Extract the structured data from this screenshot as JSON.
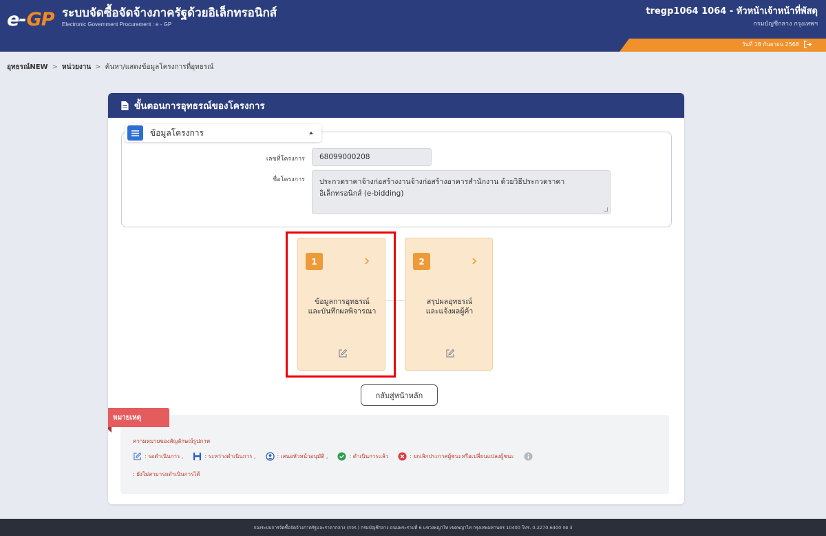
{
  "header": {
    "logo_e": "e-",
    "logo_gp": "GP",
    "title": "ระบบจัดซื้อจัดจ้างภาครัฐด้วยอิเล็กทรอนิกส์",
    "subtitle": "Electronic Government Procurement : e - GP",
    "user_name": "tregp1064 1064 - หัวหน้าเจ้าหน้าที่พัสดุ",
    "user_org": "กรมบัญชีกลาง กรุงเทพฯ",
    "date": "วันที่ 18 กันยายน 2568"
  },
  "breadcrumb": {
    "item1": "อุทธรณ์NEW",
    "item2": "หน่วยงาน",
    "item3": "ค้นหา/แสดงข้อมูลโครงการที่อุทธรณ์",
    "sep": ">"
  },
  "card": {
    "title": "ขั้นตอนการอุทธรณ์ของโครงการ",
    "section_label": "ข้อมูลโครงการ",
    "project_number_label": "เลขที่โครงการ",
    "project_number": "68099000208",
    "project_name_label": "ชื่อโครงการ",
    "project_name": "ประกวดราคาจ้างก่อสร้างงานจ้างก่อสร้างอาคารสำนักงาน ด้วยวิธีประกวดราคาอิเล็กทรอนิกส์ (e-bidding)"
  },
  "steps": [
    {
      "number": "1",
      "line1": "ข้อมูลการอุทธรณ์",
      "line2": "และบันทึกผลพิจารณา"
    },
    {
      "number": "2",
      "line1": "สรุปผลอุทธรณ์",
      "line2": "และแจ้งผลผู้ค้า"
    }
  ],
  "back_button": "กลับสู่หน้าหลัก",
  "note": {
    "ribbon": "หมายเหตุ",
    "heading": "ความหมายของสัญลักษณ์รูปภาพ",
    "items": [
      {
        "icon": "edit-icon",
        "text": ": รอดำเนินการ ,"
      },
      {
        "icon": "save-icon",
        "text": ": ระหว่างดำเนินการ ,"
      },
      {
        "icon": "user-icon",
        "text": ": เสนอหัวหน้าอนุมัติ ,"
      },
      {
        "icon": "check-circle-icon",
        "text": ": ดำเนินการแล้ว"
      },
      {
        "icon": "cancel-circle-icon",
        "text": ": ยกเลิกประกาศผู้ชนะหรือเปลี่ยนแปลงผู้ชนะ"
      },
      {
        "icon": "info-circle-icon",
        "text": ""
      }
    ],
    "last_line": ": ยังไม่สามารถดำเนินการได้"
  },
  "footer": "กองระบบการจัดซื้อจัดจ้างภาครัฐและราคากลาง (กจร.) กรมบัญชีกลาง ถนนพระรามที่ 6 แขวงพญาไท เขตพญาไท กรุงเทพมหานคร 10400 โทร. 0-2270-6400 กด 3",
  "colors": {
    "navy": "#2b3d7c",
    "orange": "#f0912b",
    "step_bg": "#fbe7cc",
    "step_num": "#ee9a38",
    "highlight": "#e00000",
    "note_red": "#e55c5f"
  }
}
